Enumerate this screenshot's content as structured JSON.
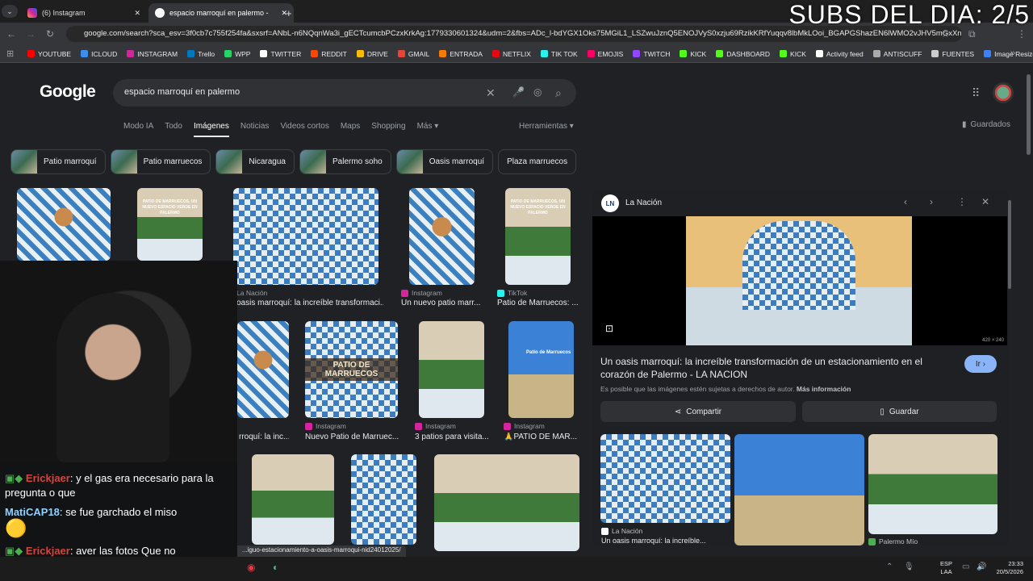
{
  "browser": {
    "tabs": [
      {
        "title": "(6) Instagram",
        "active": false
      },
      {
        "title": "espacio marroquí en palermo -",
        "active": true
      }
    ],
    "url": "google.com/search?sca_esv=3f0cb7c755f254fa&sxsrf=ANbL-n6NQqnWa3i_gECTcumcbPCzxKrkAg:1779330601324&udm=2&fbs=ADc_l-bdYGX1Oks75MGiL1_LSZwuJznQ5ENOJVyS0xzju69RzikKRfYuqqv8lbMkLOoi_BGAPGShazEN6lWMO2vJHV5mGxXn7cx...",
    "bookmarks": [
      "YOUTUBE",
      "ICLOUD",
      "INSTAGRAM",
      "Trello",
      "WPP",
      "TWITTER",
      "REDDIT",
      "DRIVE",
      "GMAIL",
      "ENTRADA",
      "NETFLIX",
      "TIK TOK",
      "EMOJIS",
      "TWITCH",
      "KICK",
      "DASHBOARD",
      "KICK",
      "Activity feed",
      "ANTISCUFF",
      "FUENTES",
      "Image Resizer | Resi..."
    ]
  },
  "overlay": {
    "subs": "SUBS DEL DIA: 2/5"
  },
  "google": {
    "logo": "Google",
    "query": "espacio marroquí en palermo",
    "nav": [
      "Modo IA",
      "Todo",
      "Imágenes",
      "Noticias",
      "Videos cortos",
      "Maps",
      "Shopping",
      "Más"
    ],
    "tools": "Herramientas",
    "saved": "Guardados",
    "chips": [
      "Patio marroquí",
      "Patio marruecos",
      "Nicaragua",
      "Palermo soho",
      "Oasis marroquí",
      "Plaza marruecos"
    ]
  },
  "results": [
    {
      "source": "La Nación",
      "caption": "oasis marroquí: la increíble transformaci..."
    },
    {
      "source": "Instagram",
      "caption": "Un nuevo patio marr..."
    },
    {
      "source": "TikTok",
      "caption": "Patio de Marruecos: ..."
    },
    {
      "source": "",
      "caption": "rroquí: la inc..."
    },
    {
      "source": "Instagram",
      "caption": "Nuevo Patio de Marruec..."
    },
    {
      "source": "Instagram",
      "caption": "3 patios para visita..."
    },
    {
      "source": "Instagram",
      "caption": "🙏PATIO DE MAR..."
    }
  ],
  "thumb_texts": {
    "patio_title": "PATIO DE MARRUECOS, UN NUEVO ESPACIO VERDE EN PALERMO",
    "patio_sign": "PATIO DE MARRUECOS",
    "patio_small": "Patio de Marruecos"
  },
  "panel": {
    "source": "La Nación",
    "source_abbr": "LN",
    "dimensions": "420 × 240",
    "title": "Un oasis marroquí: la increíble transformación de un estacionamiento en el corazón de Palermo - LA NACION",
    "ir": "Ir",
    "copyright": "Es posible que las imágenes estén sujetas a derechos de autor.",
    "more_info": "Más información",
    "share": "Compartir",
    "save": "Guardar",
    "related": [
      {
        "source": "La Nación",
        "caption": "Un oasis marroquí: la increíble..."
      },
      {
        "source": "",
        "caption": ""
      },
      {
        "source": "Palermo Mío",
        "caption": ""
      }
    ]
  },
  "status_url": "...iguo-estacionamiento-a-oasis-marroqui-nid24012025/",
  "chat": [
    {
      "user": "Erickjaer",
      "text": "y el gas era necesario para la pregunta o que",
      "color": "#d6453d"
    },
    {
      "user": "MatiCAP18",
      "text": "se fue garchado el miso",
      "color": "#8fd0ff"
    },
    {
      "user": "Erickjaer",
      "text": "aver las fotos Que no subiste",
      "color": "#d6453d"
    }
  ],
  "taskbar": {
    "lang": "ESP",
    "lang2": "LAA",
    "time": "23:33",
    "date": "20/5/2026"
  }
}
